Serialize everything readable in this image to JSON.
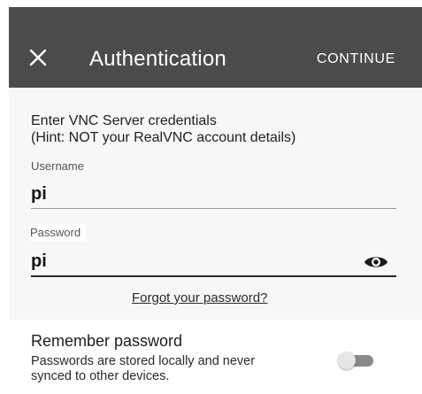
{
  "header": {
    "close_icon": "close-icon",
    "title": "Authentication",
    "continue_label": "CONTINUE"
  },
  "form": {
    "instructions_line1": "Enter VNC Server credentials",
    "instructions_line2": "(Hint: NOT your RealVNC account details)",
    "username_label": "Username",
    "username_value": "pi",
    "password_label": "Password",
    "password_value": "pi",
    "show_password_icon": "eye-icon",
    "forgot_password": "Forgot your password?"
  },
  "remember": {
    "title": "Remember password",
    "description_line1": "Passwords are stored locally and never",
    "description_line2": "synced to other devices.",
    "enabled": false
  },
  "colors": {
    "appbar": "#4b4b4b",
    "form_background": "#f7f7f7",
    "text": "#1f1f1f"
  }
}
